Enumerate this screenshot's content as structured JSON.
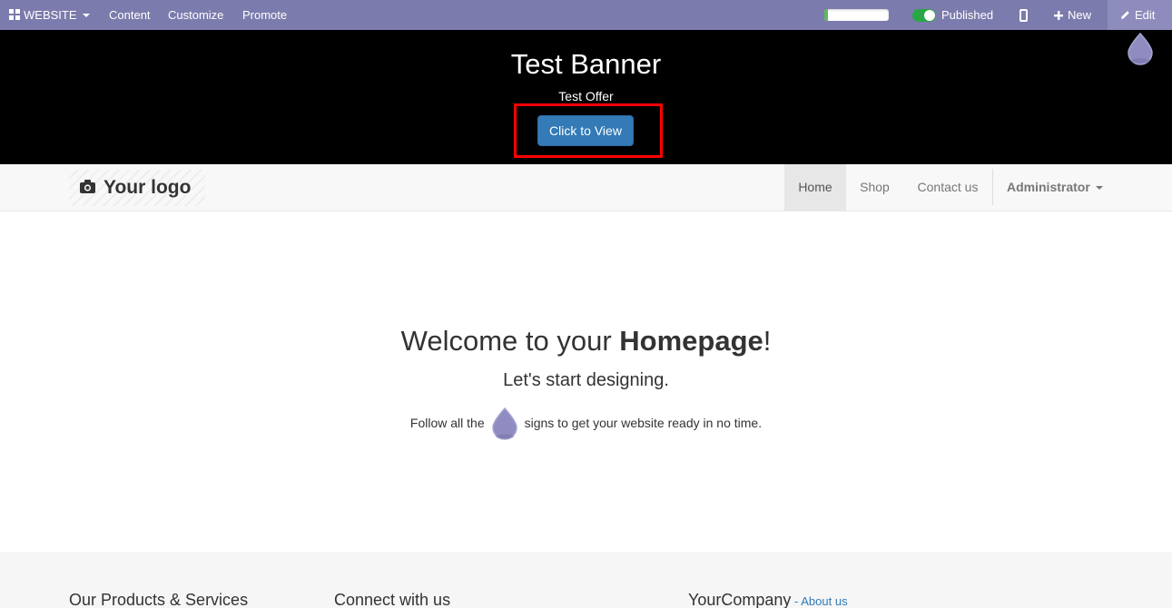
{
  "topbar": {
    "website_label": "WEBSITE",
    "menu": [
      "Content",
      "Customize",
      "Promote"
    ],
    "progress_percent": 6,
    "published_label": "Published",
    "new_label": "New",
    "edit_label": "Edit",
    "bg_color": "#7c7bad"
  },
  "banner": {
    "title": "Test Banner",
    "subtitle": "Test Offer",
    "button_label": "Click to View",
    "highlight_color": "#ff0000"
  },
  "navbar": {
    "logo_text": "Your logo",
    "links": [
      "Home",
      "Shop",
      "Contact us"
    ],
    "active_link": "Home",
    "user_label": "Administrator"
  },
  "main": {
    "welcome_prefix": "Welcome to your ",
    "welcome_bold": "Homepage",
    "welcome_suffix": "!",
    "subtitle": "Let's start designing.",
    "follow_prefix": "Follow all the",
    "follow_suffix": "signs to get your website ready in no time."
  },
  "footer": {
    "col1_title": "Our Products & Services",
    "col2_title": "Connect with us",
    "col3_title": "YourCompany",
    "col3_dash": " - ",
    "col3_link": "About us"
  },
  "icons": {
    "apps": "apps-grid-icon",
    "mobile": "mobile-preview-icon",
    "new": "plus-icon",
    "edit": "pencil-icon",
    "drop": "drop-hint-icon",
    "camera": "camera-icon"
  }
}
